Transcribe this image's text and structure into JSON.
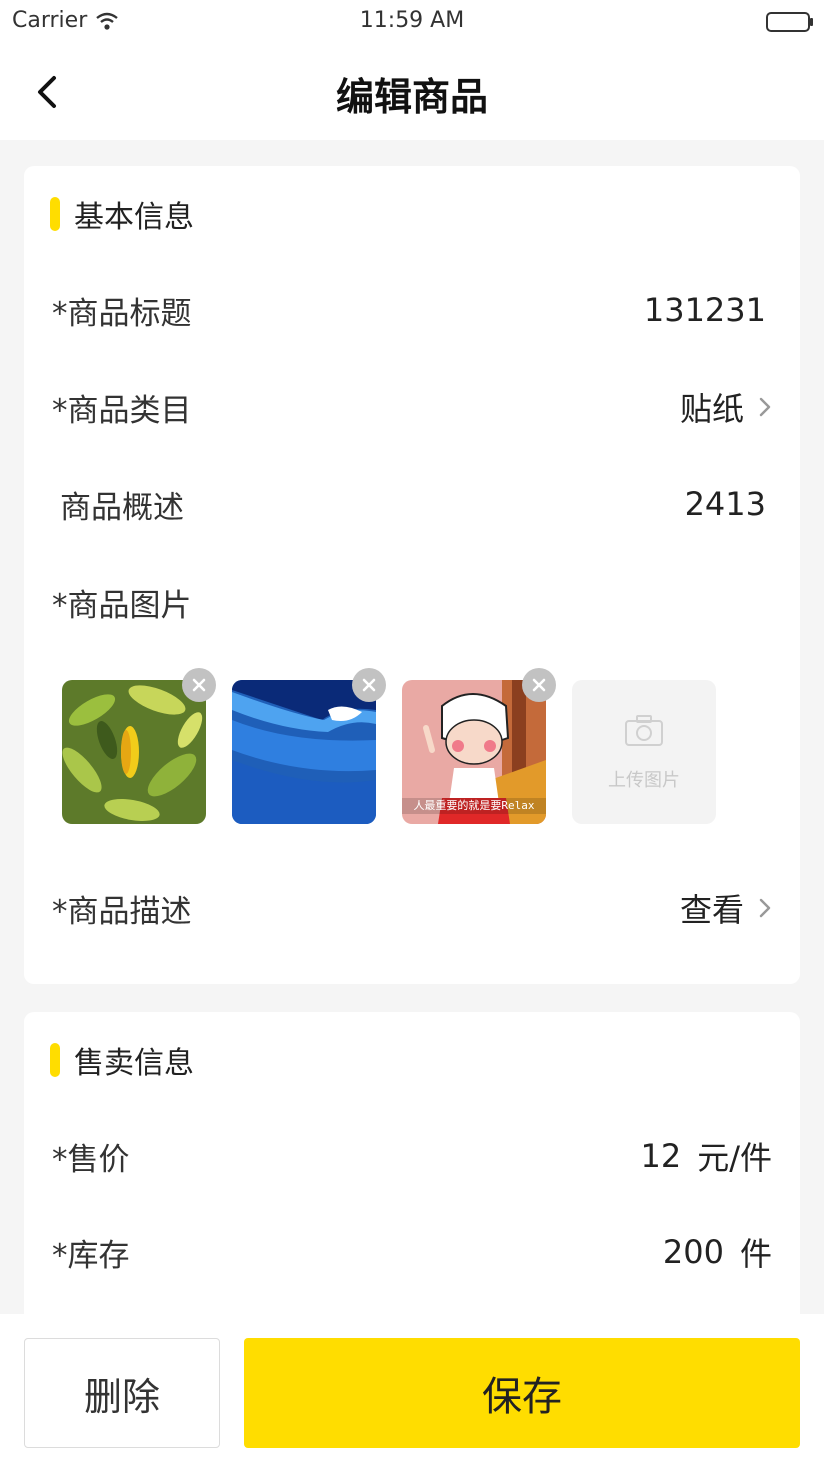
{
  "status_bar": {
    "carrier": "Carrier",
    "time": "11:59 AM",
    "wifi_icon": "wifi-icon",
    "battery_icon": "battery-icon"
  },
  "nav": {
    "back_icon": "chevron-left-icon",
    "title": "编辑商品"
  },
  "basic_info": {
    "section_title": "基本信息",
    "title_label": "*商品标题",
    "title_value": "131231",
    "category_label": "*商品类目",
    "category_value": "贴纸",
    "summary_label": "商品概述",
    "summary_value": "2413",
    "images_label": "*商品图片",
    "images": [
      {
        "name": "leaves-photo"
      },
      {
        "name": "blue-wave-photo"
      },
      {
        "name": "cartoon-girl-photo",
        "caption": "人最重要的就是要Relax"
      }
    ],
    "upload_label": "上传图片",
    "description_label": "*商品描述",
    "description_action": "查看"
  },
  "sale_info": {
    "section_title": "售卖信息",
    "price_label": "*售价",
    "price_value": "12",
    "price_unit": "元/件",
    "stock_label": "*库存",
    "stock_value": "200",
    "stock_unit": "件"
  },
  "actions": {
    "delete_label": "删除",
    "save_label": "保存"
  },
  "colors": {
    "accent": "#ffdd00",
    "background": "#f5f5f5",
    "card": "#ffffff"
  }
}
